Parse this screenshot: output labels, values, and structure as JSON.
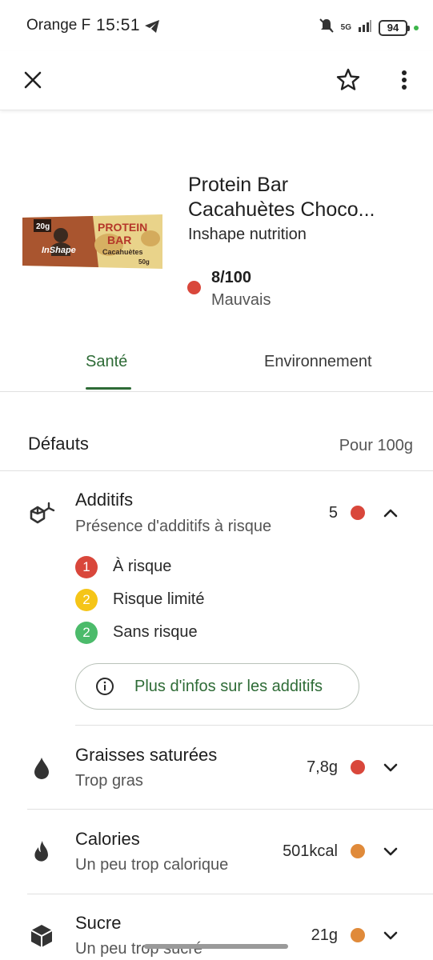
{
  "status_bar": {
    "carrier": "Orange F",
    "time": "15:51",
    "network": "5G",
    "battery": "94"
  },
  "app_bar": {
    "close_icon": "close-icon",
    "favorite_icon": "star-outline-icon",
    "more_icon": "more-vert-icon"
  },
  "product": {
    "title_line1": "Protein Bar",
    "title_line2": "Cacahuètes Choco...",
    "brand": "Inshape nutrition",
    "score": "8/100",
    "score_label": "Mauvais",
    "score_color": "#d9473b",
    "image": {
      "brand_text": "InShape",
      "name_line1": "PROTEIN",
      "name_line2": "BAR",
      "flavor": "Cacahuètes",
      "protein_badge": "20g",
      "weight": "50g"
    }
  },
  "tabs": [
    {
      "label": "Santé",
      "active": true
    },
    {
      "label": "Environnement",
      "active": false
    }
  ],
  "section": {
    "title": "Défauts",
    "unit": "Pour 100g"
  },
  "items": {
    "additives": {
      "title": "Additifs",
      "subtitle": "Présence d'additifs à risque",
      "value": "5",
      "dot_color": "#d9473b",
      "icon": "molecule-icon",
      "expanded": true,
      "breakdown": [
        {
          "count": "1",
          "label": "À risque",
          "color": "#d9473b"
        },
        {
          "count": "2",
          "label": "Risque limité",
          "color": "#f5c518"
        },
        {
          "count": "2",
          "label": "Sans risque",
          "color": "#4cbb6b"
        }
      ],
      "more_button": "Plus d'infos sur les additifs"
    },
    "saturated_fat": {
      "title": "Graisses saturées",
      "subtitle": "Trop gras",
      "value": "7,8g",
      "dot_color": "#d9473b",
      "icon": "drop-icon"
    },
    "calories": {
      "title": "Calories",
      "subtitle": "Un peu trop calorique",
      "value": "501kcal",
      "dot_color": "#e08a3a",
      "icon": "flame-icon"
    },
    "sugar": {
      "title": "Sucre",
      "subtitle": "Un peu trop sucré",
      "value": "21g",
      "dot_color": "#e08a3a",
      "icon": "sugar-cube-icon"
    }
  }
}
